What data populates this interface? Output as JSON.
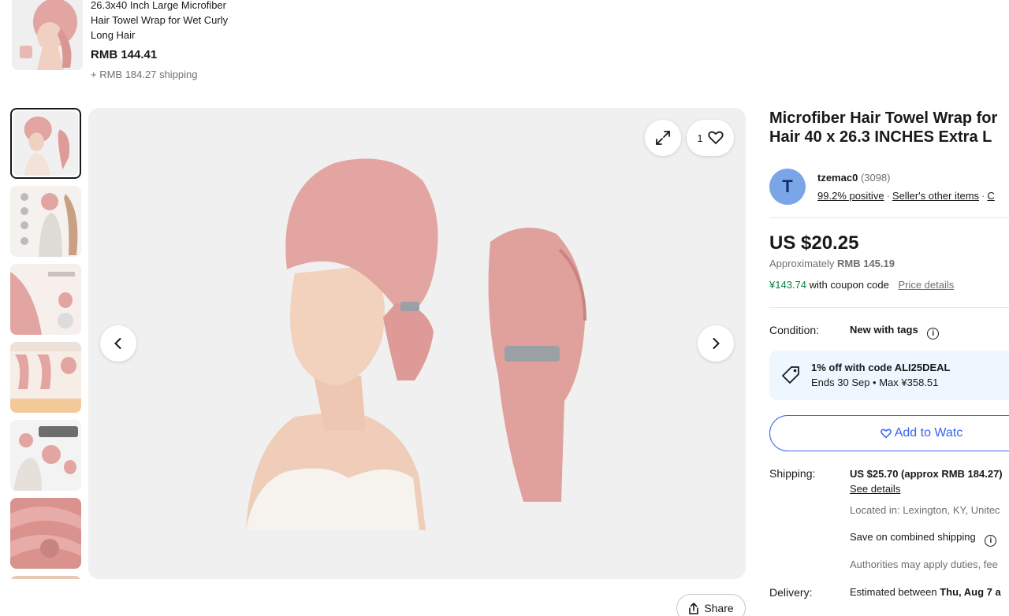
{
  "sticky_header": {
    "title": "26.3x40 Inch Large Microfiber Hair Towel Wrap for Wet Curly Long Hair",
    "price": "RMB 144.41",
    "shipping": "+ RMB 184.27 shipping"
  },
  "gallery": {
    "thumbnail_count": 7,
    "selected_index": 0,
    "watch_count": "1",
    "icons": {
      "expand": "expand-icon",
      "watch": "heart-icon",
      "prev": "chevron-left-icon",
      "next": "chevron-right-icon",
      "share": "share-icon"
    },
    "share_label": "Share"
  },
  "listing": {
    "title_line1": "Microfiber Hair Towel Wrap for",
    "title_line2": "Hair 40 x 26.3 INCHES Extra L"
  },
  "seller": {
    "avatar_letter": "T",
    "name": "tzemac0",
    "feedback_count": "(3098)",
    "positive": "99.2% positive",
    "other_items": "Seller's other items",
    "contact": "C"
  },
  "pricing": {
    "price": "US $20.25",
    "approx_label": "Approximately",
    "approx_value": "RMB 145.19",
    "coupon_price": "¥143.74",
    "coupon_text": "with coupon code",
    "price_details": "Price details"
  },
  "condition": {
    "label": "Condition:",
    "value": "New with tags"
  },
  "promo": {
    "line1": "1% off with code ALI25DEAL",
    "line2": "Ends 30 Sep • Max ¥358.51"
  },
  "actions": {
    "add_to_watchlist": "Add to Watc"
  },
  "shipping": {
    "label": "Shipping:",
    "cost": "US $25.70 (approx RMB 184.27)",
    "see_details": "See details",
    "located": "Located in: Lexington, KY, Unitec",
    "combined": "Save on combined shipping",
    "duties": "Authorities may apply duties, fee"
  },
  "delivery": {
    "label": "Delivery:",
    "estimate_prefix": "Estimated between",
    "estimate_date": "Thu, Aug 7 a"
  },
  "colors": {
    "accent_blue": "#3665f3",
    "coupon_green": "#05823f",
    "promo_bg": "#eef6ff",
    "avatar_bg": "#7aa6e8",
    "towel_pink": "#e3a5a1"
  }
}
